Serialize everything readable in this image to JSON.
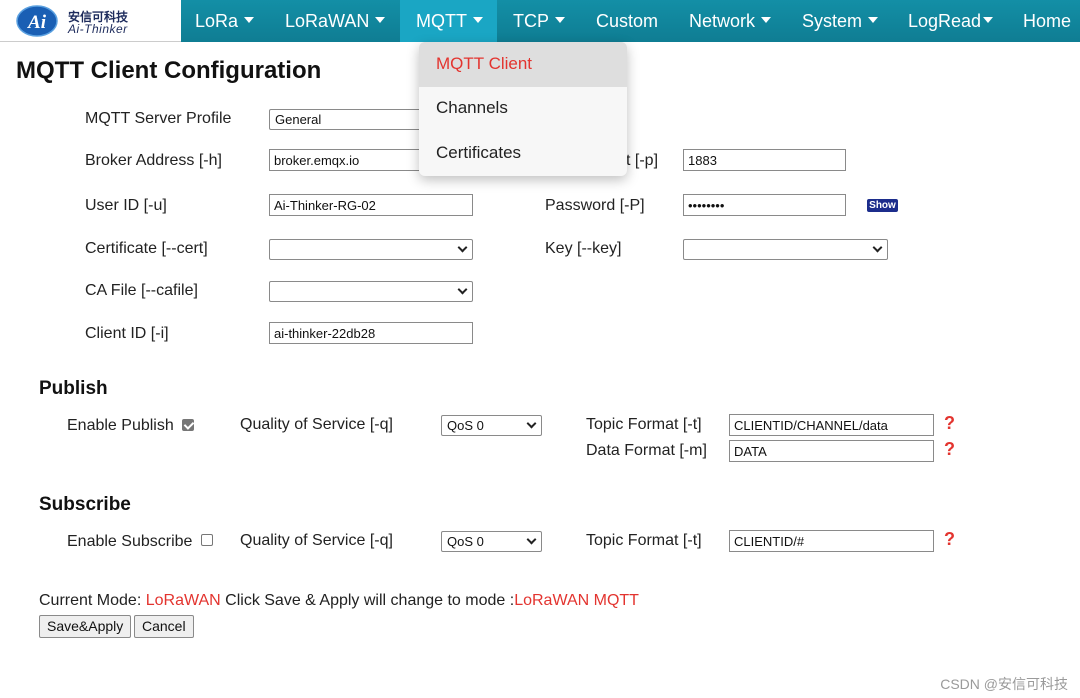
{
  "brand": {
    "name_cn": "安信可科技",
    "name_en": "Ai-Thinker",
    "logo_text": "Ai"
  },
  "nav": {
    "items": [
      {
        "label": "LoRa",
        "caret": true
      },
      {
        "label": "LoRaWAN",
        "caret": true
      },
      {
        "label": "MQTT",
        "caret": true
      },
      {
        "label": "TCP",
        "caret": true
      },
      {
        "label": "Custom",
        "caret": false
      },
      {
        "label": "Network",
        "caret": true
      },
      {
        "label": "System",
        "caret": true
      },
      {
        "label": "LogRead",
        "caret": true
      },
      {
        "label": "Home",
        "caret": false
      }
    ],
    "active": "MQTT"
  },
  "dropdown": {
    "items": [
      "MQTT Client",
      "Channels",
      "Certificates"
    ],
    "active": "MQTT Client"
  },
  "page": {
    "title": "MQTT Client Configuration",
    "server_profile": {
      "label": "MQTT Server Profile",
      "value": "General"
    },
    "broker": {
      "label": "Broker Address [-h]",
      "value": "broker.emqx.io"
    },
    "port": {
      "label_visible": "t [-p]",
      "value": "1883"
    },
    "user_id": {
      "label": "User ID [-u]",
      "value": "Ai-Thinker-RG-02"
    },
    "password": {
      "label": "Password [-P]",
      "value": "••••••••",
      "show_label": "Show"
    },
    "certificate": {
      "label": "Certificate [--cert]",
      "value": ""
    },
    "key": {
      "label": "Key [--key]",
      "value": ""
    },
    "ca_file": {
      "label": "CA File [--cafile]",
      "value": ""
    },
    "client_id": {
      "label": "Client ID [-i]",
      "value": "ai-thinker-22db28"
    }
  },
  "publish": {
    "title": "Publish",
    "enable_label": "Enable Publish",
    "enabled": true,
    "qos_label": "Quality of Service [-q]",
    "qos_value": "QoS 0",
    "topic_label": "Topic Format [-t]",
    "topic_value": "CLIENTID/CHANNEL/data",
    "data_label": "Data Format [-m]",
    "data_value": "DATA",
    "help": "?"
  },
  "subscribe": {
    "title": "Subscribe",
    "enable_label": "Enable Subscribe",
    "enabled": false,
    "qos_label": "Quality of Service [-q]",
    "qos_value": "QoS 0",
    "topic_label": "Topic Format [-t]",
    "topic_value": "CLIENTID/#",
    "help": "?"
  },
  "mode": {
    "prefix": "Current Mode: ",
    "current": "LoRaWAN",
    "middle": " Click Save & Apply will change to mode :",
    "next": "LoRaWAN MQTT"
  },
  "buttons": {
    "save_apply": "Save&Apply",
    "cancel": "Cancel"
  },
  "watermark": "CSDN @安信可科技",
  "colors": {
    "nav_bg": "#138fa6",
    "nav_active": "#1aa6c4",
    "accent_red": "#e3342f",
    "show_btn": "#1c2d8c"
  }
}
